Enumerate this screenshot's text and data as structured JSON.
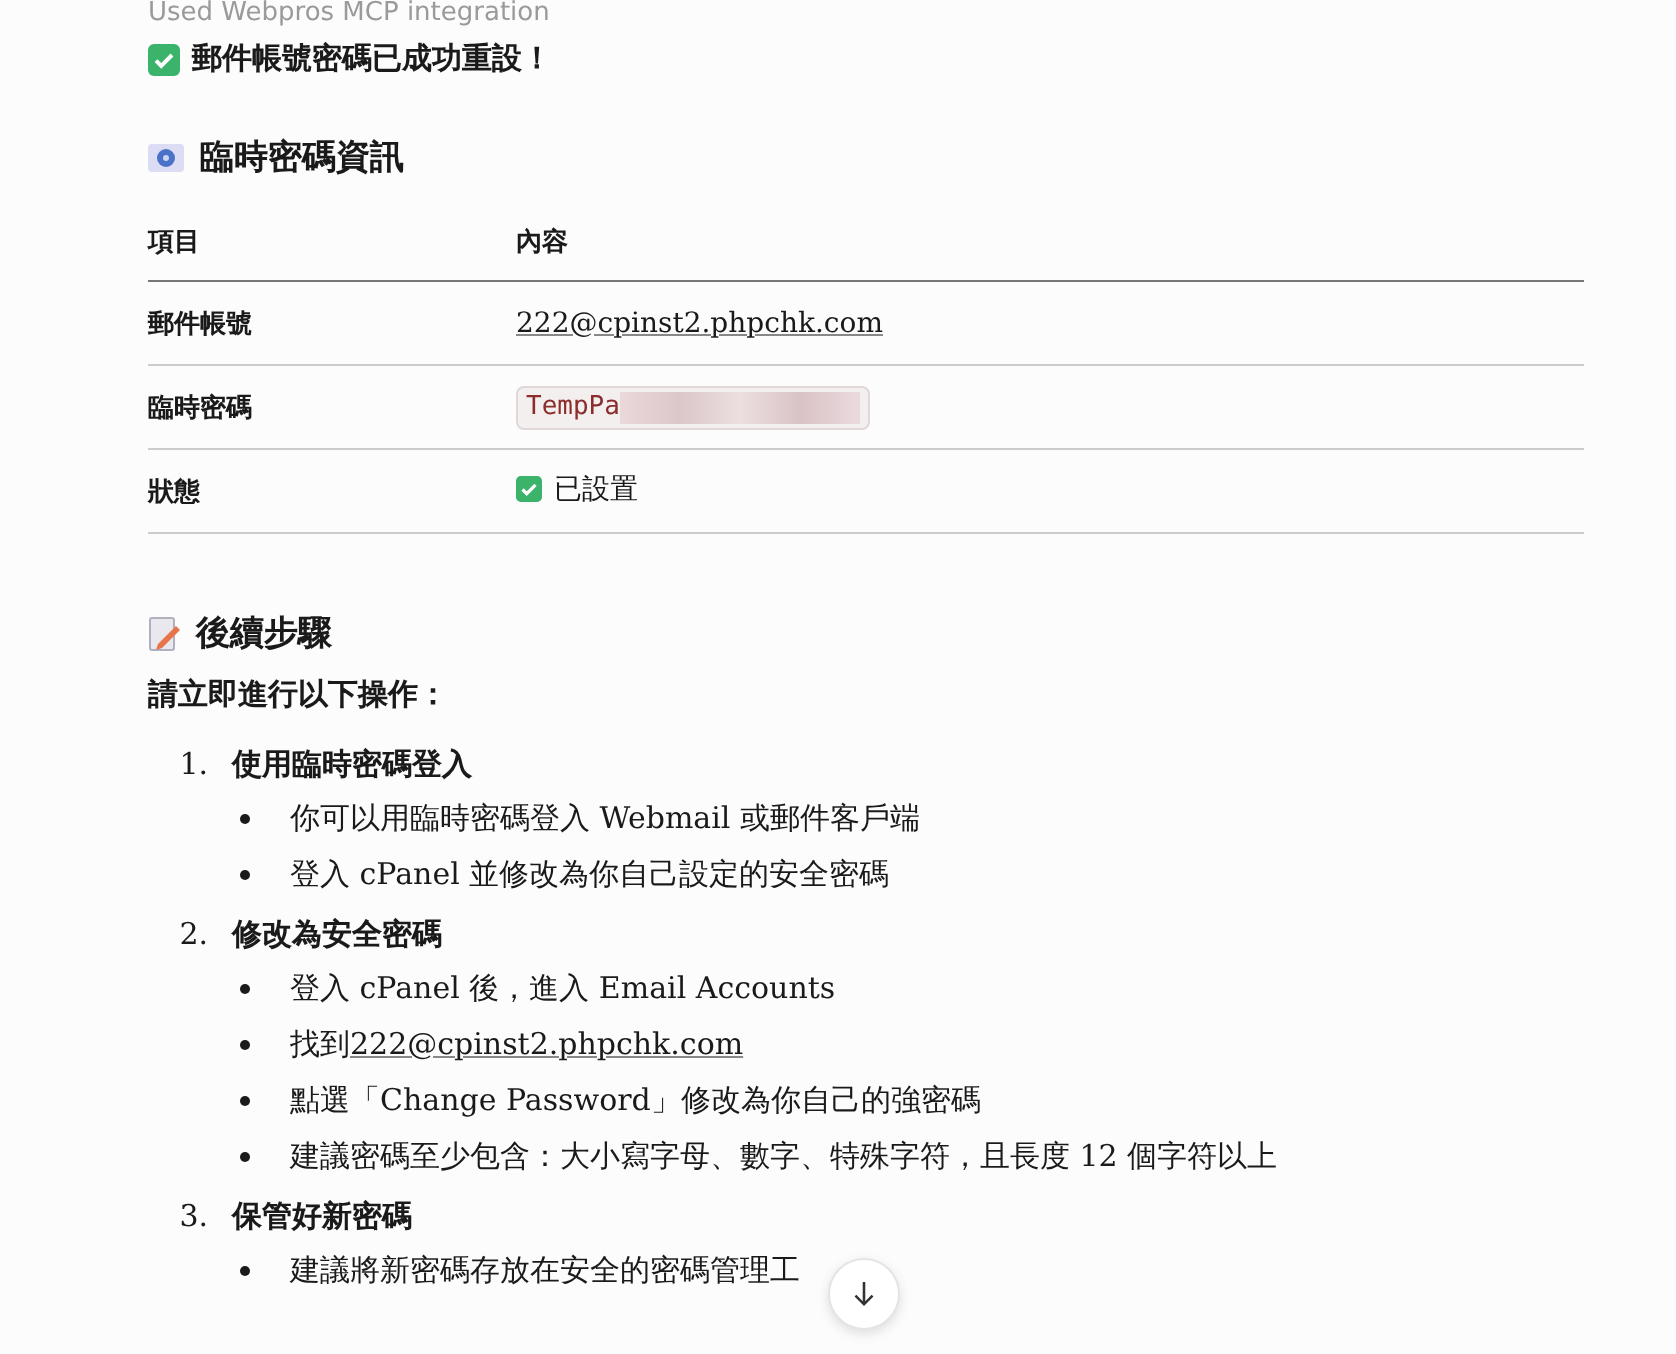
{
  "tool_note": "Used Webpros MCP integration",
  "success_message": "郵件帳號密碼已成功重設！",
  "info_section": {
    "title": "臨時密碼資訊",
    "columns": [
      "項目",
      "內容"
    ],
    "rows": [
      {
        "kind": "link",
        "label": "郵件帳號",
        "value": "222@cpinst2.phpchk.com"
      },
      {
        "kind": "code",
        "label": "臨時密碼",
        "value": "TempPa",
        "redacted": true
      },
      {
        "kind": "status",
        "label": "狀態",
        "value": "已設置"
      }
    ]
  },
  "steps_section": {
    "title": "後續步驟",
    "intro": "請立即進行以下操作：",
    "steps": [
      {
        "number": "1.",
        "title": "使用臨時密碼登入",
        "bullets": [
          {
            "text": "你可以用臨時密碼登入 Webmail 或郵件客戶端"
          },
          {
            "text": "登入 cPanel 並修改為你自己設定的安全密碼"
          }
        ]
      },
      {
        "number": "2.",
        "title": "修改為安全密碼",
        "bullets": [
          {
            "text": "登入 cPanel 後，進入 Email Accounts"
          },
          {
            "text": "找到",
            "link": "222@cpinst2.phpchk.com"
          },
          {
            "text": "點選「Change Password」修改為你自己的強密碼"
          },
          {
            "text": "建議密碼至少包含：大小寫字母、數字、特殊字符，且長度 12 個字符以上"
          }
        ]
      },
      {
        "number": "3.",
        "title": "保管好新密碼",
        "bullets": [
          {
            "text": "建議將新密碼存放在安全的密碼管理工"
          }
        ]
      }
    ]
  }
}
